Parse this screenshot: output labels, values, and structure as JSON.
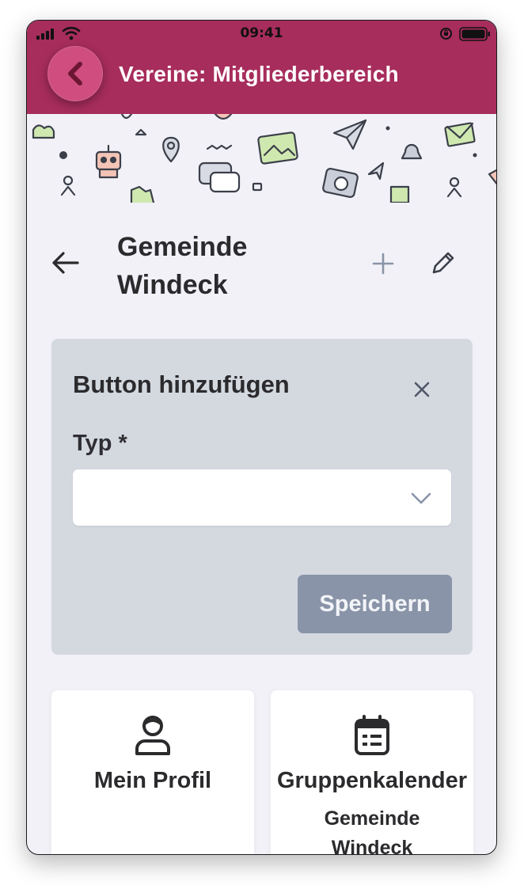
{
  "status_bar": {
    "time": "09:41"
  },
  "app_bar": {
    "title": "Vereine: Mitgliederbereich"
  },
  "page": {
    "title": "Gemeinde Windeck"
  },
  "panel": {
    "title": "Button hinzufügen",
    "field_label": "Typ *",
    "select_value": "",
    "save_label": "Speichern"
  },
  "cards": [
    {
      "label": "Mein Profil",
      "sub": ""
    },
    {
      "label": "Gruppenkalender",
      "sub_line1": "Gemeinde",
      "sub_line2": "Windeck"
    }
  ],
  "colors": {
    "brand": "#a72d5c",
    "back_button": "#cf4e7f",
    "panel_bg": "#d4d9e0",
    "save_button": "#8a94a8",
    "page_bg": "#f1f1f7"
  },
  "icons": [
    "signal-icon",
    "wifi-icon",
    "rotation-lock-icon",
    "battery-icon",
    "chevron-left-icon",
    "arrow-left-icon",
    "plus-icon",
    "pencil-icon",
    "close-icon",
    "chevron-down-icon",
    "user-icon",
    "calendar-icon"
  ]
}
